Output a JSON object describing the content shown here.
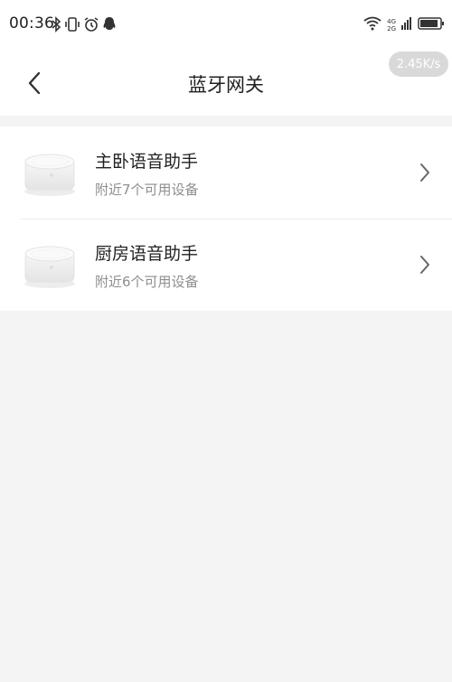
{
  "status_bar": {
    "time": "00:36",
    "left_icons": [
      "bluetooth-icon",
      "vibrate-icon",
      "alarm-icon",
      "qq-icon"
    ],
    "network": {
      "top": "4G",
      "bottom": "2G"
    },
    "speed": "2.45K/s"
  },
  "header": {
    "back_icon": "chevron-left-icon",
    "title": "蓝牙网关"
  },
  "devices": [
    {
      "name": "主卧语音助手",
      "subtitle": "附近7个可用设备"
    },
    {
      "name": "厨房语音助手",
      "subtitle": "附近6个可用设备"
    }
  ],
  "colors": {
    "background": "#f4f4f4",
    "surface": "#ffffff",
    "text_primary": "#222222",
    "text_secondary": "#8e8e8e",
    "divider": "#ececec",
    "badge": "#d9d9d9"
  }
}
